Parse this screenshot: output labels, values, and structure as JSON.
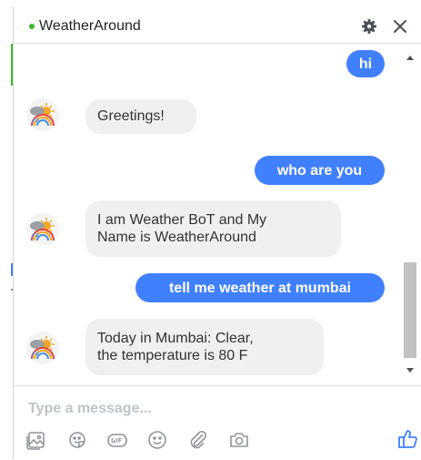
{
  "header": {
    "title": "WeatherAround",
    "status_color": "#42b72a",
    "icons": [
      "gear-icon",
      "close-icon"
    ]
  },
  "colors": {
    "outgoing_bubble": "#4080ff",
    "incoming_bubble": "#f1f0f0",
    "accent": "#4080ff"
  },
  "messages": [
    {
      "from": "user",
      "text": "hi"
    },
    {
      "from": "bot",
      "text": "Greetings!"
    },
    {
      "from": "user",
      "text": "who are you"
    },
    {
      "from": "bot",
      "lines": [
        "I am Weather BoT and My",
        "Name is WeatherAround"
      ]
    },
    {
      "from": "user",
      "text": "tell me weather at mumbai"
    },
    {
      "from": "bot",
      "lines": [
        "Today in Mumbai: Clear,",
        "the temperature is 80 F"
      ]
    }
  ],
  "composer": {
    "placeholder": "Type a message...",
    "value": "",
    "tools": [
      "photo-icon",
      "sticker-icon",
      "gif-icon",
      "emoji-icon",
      "attachment-icon",
      "camera-icon"
    ],
    "send_icon": "thumbs-up-icon"
  }
}
